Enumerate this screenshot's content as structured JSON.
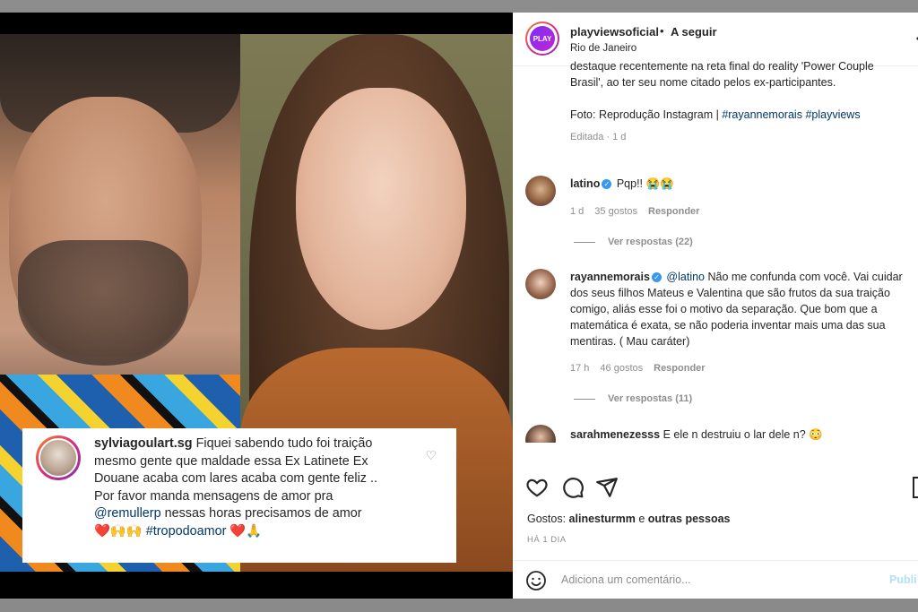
{
  "post": {
    "username": "playviewsoficial",
    "separator": "•",
    "follow_label": "A seguir",
    "location": "Rio de Janeiro",
    "avatar_text": "PLAY",
    "caption_partial_top": "destaque recentemente na reta final do reality 'Power Couple",
    "caption_line2": "Brasil', ao ter seu nome citado pelos ex-participantes.",
    "caption_photo": "Foto: Reprodução Instagram | ",
    "hashtag1": "#rayannemorais",
    "hashtag2": "#playviews",
    "edited": "Editada · 1 d"
  },
  "comments": [
    {
      "username": "latino",
      "text": "Pqp!! 😭😭",
      "time": "1 d",
      "likes": "35 gostos",
      "reply": "Responder",
      "view_replies": "Ver respostas (22)"
    },
    {
      "username": "rayannemorais",
      "mention": "@latino",
      "text": " Não me confunda com você. Vai cuidar dos seus filhos Mateus e Valentina que são frutos da sua traição comigo, aliás esse foi o motivo da separação. Que bom que a matemática é exata, se não poderia inventar mais uma das sua mentiras. ( Mau caráter)",
      "time": "17 h",
      "likes": "46 gostos",
      "reply": "Responder",
      "view_replies": "Ver respostas (11)"
    },
    {
      "username": "sarahmenezesss",
      "text": "E ele n destruiu o lar dele n? 😳"
    }
  ],
  "overlay_comment": {
    "username": "sylviagoulart.sg",
    "text1": " Fiquei sabendo tudo foi traição mesmo gente que maldade essa Ex Latinete Ex Douane acaba com lares acaba com gente feliz ..",
    "text2": "Por favor manda mensagens de amor pra",
    "mention": "@remullerp",
    "text3": " nessas horas precisamos de amor",
    "emojis": "❤️🙌🙌 ",
    "hashtag": "#tropodoamor",
    "emojis_end": " ❤️🙏"
  },
  "footer": {
    "likes_prefix": "Gostos: ",
    "likes_user": "alinesturmm",
    "likes_middle": " e ",
    "likes_others": "outras pessoas",
    "when": "HÁ 1 DIA",
    "comment_placeholder": "Adiciona um comentário...",
    "post_label": "Publi"
  }
}
